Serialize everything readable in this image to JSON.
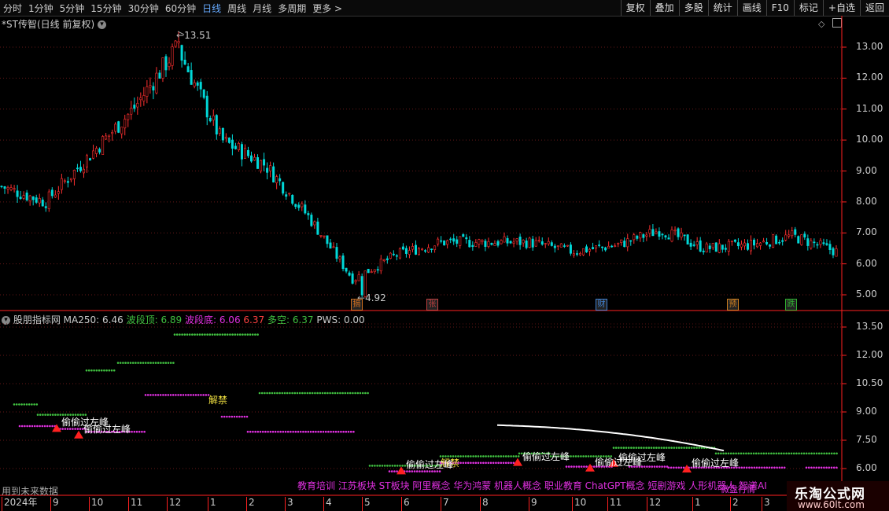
{
  "toolbar": {
    "periods": [
      "分时",
      "1分钟",
      "5分钟",
      "15分钟",
      "30分钟",
      "60分钟",
      "日线",
      "周线",
      "月线",
      "多周期",
      "更多 >"
    ],
    "active_period": "日线",
    "actions": [
      "复权",
      "叠加",
      "多股",
      "统计",
      "画线",
      "F10",
      "标记",
      "+自选",
      "返回"
    ]
  },
  "main_panel": {
    "title": "*ST传智(日线 前复权)",
    "high_label": "13.51",
    "low_label": "4.92",
    "y_ticks": [
      "13.00",
      "12.00",
      "11.00",
      "10.00",
      "9.00",
      "8.00",
      "7.00",
      "6.00",
      "5.00"
    ],
    "event_badges": [
      {
        "label": "摘",
        "color": "#d07020"
      },
      {
        "label": "张",
        "color": "#c04040"
      },
      {
        "label": "财",
        "color": "#4080d0"
      },
      {
        "label": "预",
        "color": "#d08020"
      },
      {
        "label": "跌",
        "color": "#30b030"
      }
    ]
  },
  "indicator_panel": {
    "name": "股朋指标网",
    "ma_label": "MA250:",
    "ma_value": "6.46",
    "top_label": "波段顶:",
    "top_value": "6.89",
    "bottom_label": "波段底:",
    "bottom_value": "6.06",
    "bottom_value2": "6.37",
    "long_short_label": "多空:",
    "long_short_value": "6.37",
    "pws_label": "PWS:",
    "pws_value": "0.00",
    "y_ticks": [
      "13.50",
      "12.00",
      "10.50",
      "9.00",
      "7.50",
      "6.00"
    ],
    "annotations": {
      "unlock_1": "解禁",
      "unlock_2": "解禁",
      "cross_peak": "偷偷过左峰",
      "future_data": "用到未来数据"
    },
    "concepts": "教育培训 江苏板块 ST板块 阿里概念 华为鸿蒙 机器人概念 职业教育 ChatGPT概念 短剧游戏 人形机器人 智谱AI",
    "concept_tail": "微盘行情"
  },
  "time_axis": [
    "2024年",
    "9",
    "10",
    "11",
    "12",
    "1",
    "2",
    "3",
    "4",
    "5",
    "6",
    "7",
    "8",
    "9",
    "10",
    "11",
    "12",
    "1",
    "2",
    "3"
  ],
  "watermark": {
    "title": "乐淘公式网",
    "url": "www.60lt.com"
  },
  "colors": {
    "up": "#ff3030",
    "down": "#00d8d8",
    "green_dots": "#40c040",
    "magenta_dots": "#e030e0",
    "white_line": "#ffffff",
    "axis": "#ff2020"
  },
  "chart_data": {
    "type": "candlestick",
    "title": "*ST传智(日线 前复权)",
    "y_range": [
      4.5,
      13.8
    ],
    "high": 13.51,
    "low": 4.92,
    "anchor_closes": [
      {
        "x": "2024-08",
        "y": 8.5
      },
      {
        "x": "2024-09",
        "y": 8.0
      },
      {
        "x": "2024-10",
        "y": 9.5
      },
      {
        "x": "2024-11",
        "y": 11.0
      },
      {
        "x": "2024-12",
        "y": 13.0
      },
      {
        "x": "2025-01",
        "y": 10.0
      },
      {
        "x": "2025-02",
        "y": 9.2
      },
      {
        "x": "2025-03",
        "y": 7.5
      },
      {
        "x": "2025-04",
        "y": 5.5
      },
      {
        "x": "2025-05",
        "y": 6.3
      },
      {
        "x": "2025-06",
        "y": 6.7
      },
      {
        "x": "2025-07",
        "y": 6.7
      },
      {
        "x": "2025-08",
        "y": 6.7
      },
      {
        "x": "2025-09",
        "y": 6.4
      },
      {
        "x": "2025-10",
        "y": 6.6
      },
      {
        "x": "2025-11",
        "y": 7.1
      },
      {
        "x": "2025-12",
        "y": 6.5
      },
      {
        "x": "2026-01",
        "y": 6.6
      },
      {
        "x": "2026-02",
        "y": 6.9
      },
      {
        "x": "2026-03",
        "y": 6.4
      }
    ]
  }
}
